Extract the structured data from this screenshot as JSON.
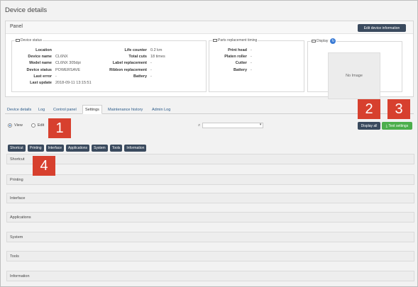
{
  "page": {
    "title": "Device details"
  },
  "panel": {
    "title": "Panel",
    "edit_button": "Edit device information"
  },
  "device_status": {
    "legend": "Device status",
    "rows": [
      {
        "k": "Location",
        "v": ""
      },
      {
        "k": "Device name",
        "v": "CL6NX"
      },
      {
        "k": "Model name",
        "v": "CL6NX 305dpi"
      },
      {
        "k": "Device status",
        "v": "POWERSAVE"
      },
      {
        "k": "Last error",
        "v": "-"
      },
      {
        "k": "Last update",
        "v": "2018-09-11 13:15:51"
      }
    ],
    "rows2": [
      {
        "k": "Life counter",
        "v": "0.2 km"
      },
      {
        "k": "Total cuts",
        "v": "18 times"
      },
      {
        "k": "Label replacement",
        "v": "-"
      },
      {
        "k": "Ribbon replacement",
        "v": "-"
      },
      {
        "k": "Battery",
        "v": "-"
      }
    ]
  },
  "parts": {
    "legend": "Parts replacement timing",
    "rows": [
      {
        "k": "Print head",
        "v": "-"
      },
      {
        "k": "Platen roller",
        "v": "-"
      },
      {
        "k": "Cutter",
        "v": "-"
      },
      {
        "k": "Battery",
        "v": "-"
      }
    ]
  },
  "display": {
    "legend": "Display",
    "no_image": "No Image",
    "refresh_icon": "refresh-icon"
  },
  "tabs": [
    "Device details",
    "Log",
    "Control panel",
    "Settings",
    "Maintenance history",
    "Admin Log"
  ],
  "active_tab": "Settings",
  "mode": {
    "view": "View",
    "edit": "Edit",
    "selected": "View"
  },
  "select": {
    "value": ""
  },
  "buttons": {
    "display_all": "Display all",
    "text_settings": "Text settings"
  },
  "category_buttons": [
    "Shortcut",
    "Printing",
    "Interface",
    "Applications",
    "System",
    "Tools",
    "Information"
  ],
  "sections": [
    "Shortcut",
    "Printing",
    "Interface",
    "Applications",
    "System",
    "Tools",
    "Information"
  ],
  "badges": [
    "1",
    "2",
    "3",
    "4"
  ],
  "colors": {
    "badge": "#d7402e",
    "dark_button": "#3a4a5e",
    "green_button": "#4cae4c"
  }
}
